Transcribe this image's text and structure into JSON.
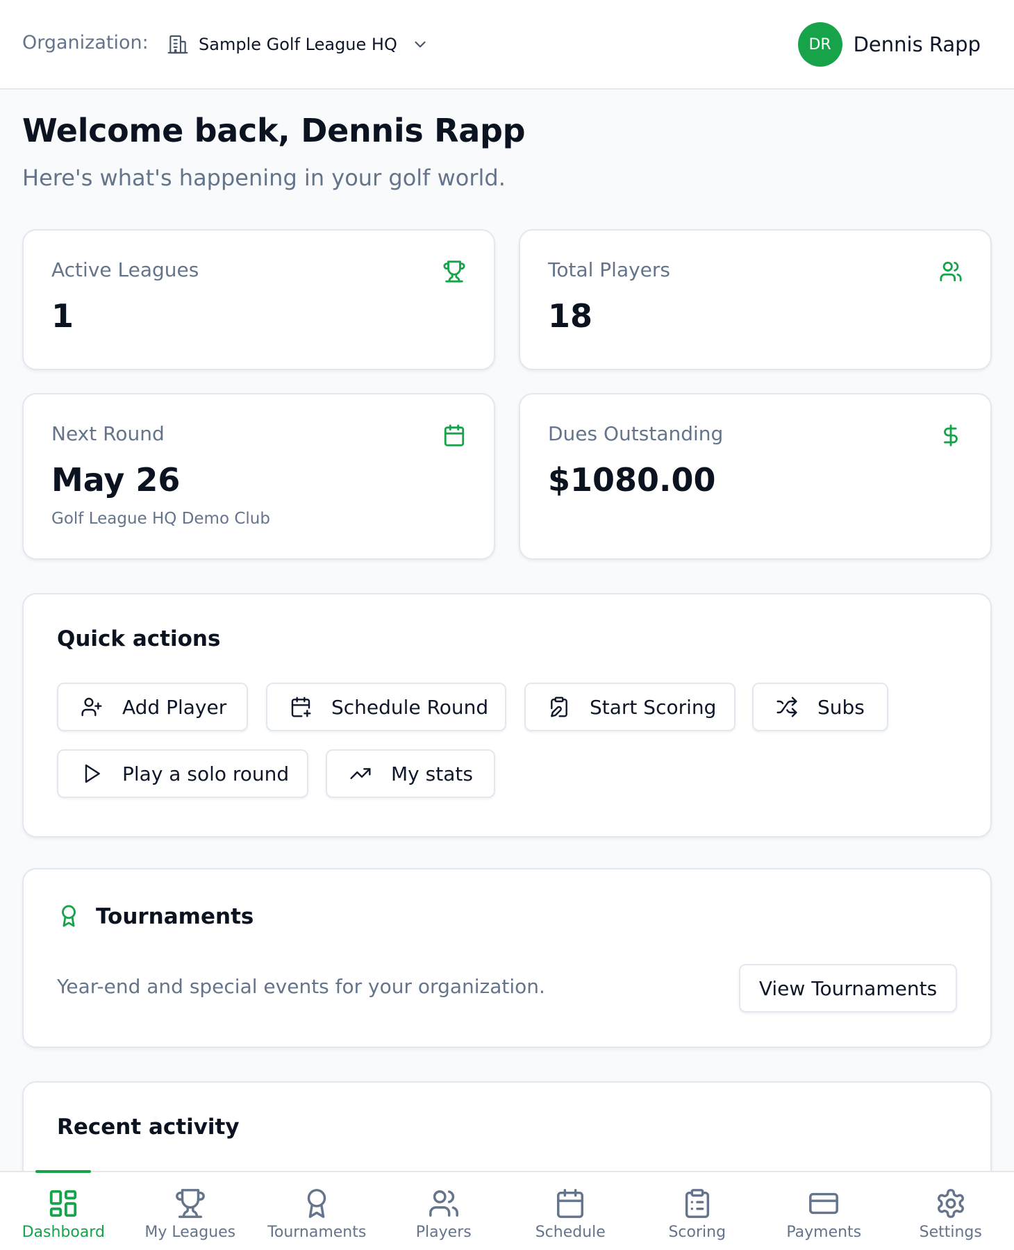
{
  "header": {
    "org_label": "Organization:",
    "org_name": "Sample Golf League HQ",
    "user_initials": "DR",
    "user_name": "Dennis Rapp"
  },
  "welcome": {
    "title": "Welcome back, Dennis Rapp",
    "subtitle": "Here's what's happening in your golf world."
  },
  "stats": {
    "active_leagues": {
      "label": "Active Leagues",
      "value": "1",
      "icon": "trophy-icon"
    },
    "total_players": {
      "label": "Total Players",
      "value": "18",
      "icon": "users-icon"
    },
    "next_round": {
      "label": "Next Round",
      "value": "May 26",
      "sub": "Golf League HQ Demo Club",
      "icon": "calendar-icon"
    },
    "dues": {
      "label": "Dues Outstanding",
      "value": "$1080.00",
      "icon": "dollar-icon"
    }
  },
  "quick_actions": {
    "title": "Quick actions",
    "buttons": [
      {
        "label": "Add Player",
        "icon": "user-plus-icon"
      },
      {
        "label": "Schedule Round",
        "icon": "calendar-plus-icon"
      },
      {
        "label": "Start Scoring",
        "icon": "clipboard-edit-icon"
      },
      {
        "label": "Subs",
        "icon": "shuffle-icon"
      },
      {
        "label": "Play a solo round",
        "icon": "play-icon"
      },
      {
        "label": "My stats",
        "icon": "trending-up-icon"
      }
    ]
  },
  "tournaments": {
    "title": "Tournaments",
    "description": "Year-end and special events for your organization.",
    "button": "View Tournaments",
    "icon": "award-icon"
  },
  "recent_activity": {
    "title": "Recent activity"
  },
  "nav": {
    "items": [
      {
        "label": "Dashboard",
        "icon": "dashboard-icon",
        "active": true
      },
      {
        "label": "My Leagues",
        "icon": "trophy-icon"
      },
      {
        "label": "Tournaments",
        "icon": "award-icon"
      },
      {
        "label": "Players",
        "icon": "users-icon"
      },
      {
        "label": "Schedule",
        "icon": "calendar-icon"
      },
      {
        "label": "Scoring",
        "icon": "clipboard-list-icon"
      },
      {
        "label": "Payments",
        "icon": "credit-card-icon"
      },
      {
        "label": "Settings",
        "icon": "gear-icon"
      }
    ]
  },
  "colors": {
    "accent": "#16a34a",
    "muted_text": "#64748b",
    "background": "#f8fafc"
  }
}
